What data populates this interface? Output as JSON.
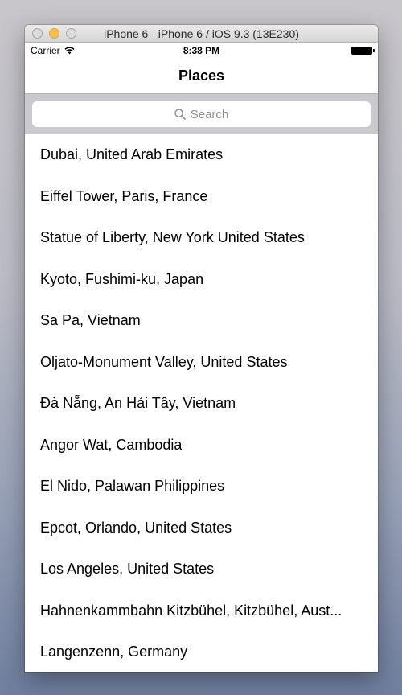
{
  "window": {
    "title": "iPhone 6 - iPhone 6 / iOS 9.3 (13E230)"
  },
  "status_bar": {
    "carrier": "Carrier",
    "time": "8:38 PM"
  },
  "nav": {
    "title": "Places"
  },
  "search": {
    "placeholder": "Search"
  },
  "places": [
    "Dubai, United Arab Emirates",
    "Eiffel Tower, Paris, France",
    "Statue of Liberty, New York United States",
    "Kyoto, Fushimi-ku, Japan",
    "Sa Pa, Vietnam",
    "Oljato-Monument Valley, United States",
    "Đà Nẵng, An Hải Tây, Vietnam",
    "Angor Wat, Cambodia",
    "El Nido, Palawan Philippines",
    "Epcot, Orlando, United States",
    "Los Angeles, United States",
    "Hahnenkammbahn Kitzbühel, Kitzbühel, Aust...",
    "Langenzenn, Germany"
  ]
}
